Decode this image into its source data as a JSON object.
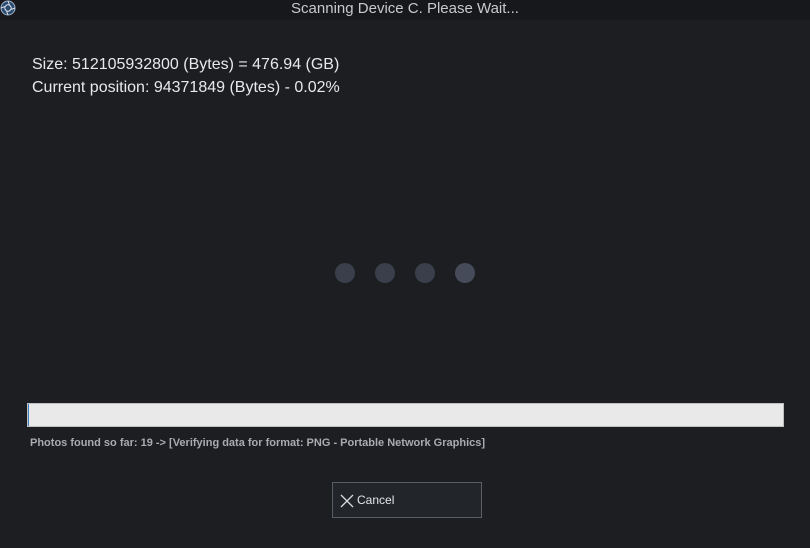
{
  "window": {
    "title": "Scanning Device C. Please Wait...",
    "app_icon": "aperture-icon"
  },
  "info": {
    "size_line": "Size: 512105932800 (Bytes) = 476.94 (GB)",
    "position_line": "Current position: 94371849 (Bytes) - 0.02%"
  },
  "spinner": {
    "icon": "loading-dots-icon",
    "dot_colors": [
      "#3a3f4b",
      "#3a3f4b",
      "#3a3f4b",
      "#454b59"
    ]
  },
  "progress": {
    "fraction": 0.0002
  },
  "status": {
    "text": "Photos found so far: 19 -> [Verifying data for format: PNG - Portable Network Graphics]"
  },
  "buttons": {
    "cancel_label": "Cancel",
    "cancel_icon": "close-icon"
  }
}
